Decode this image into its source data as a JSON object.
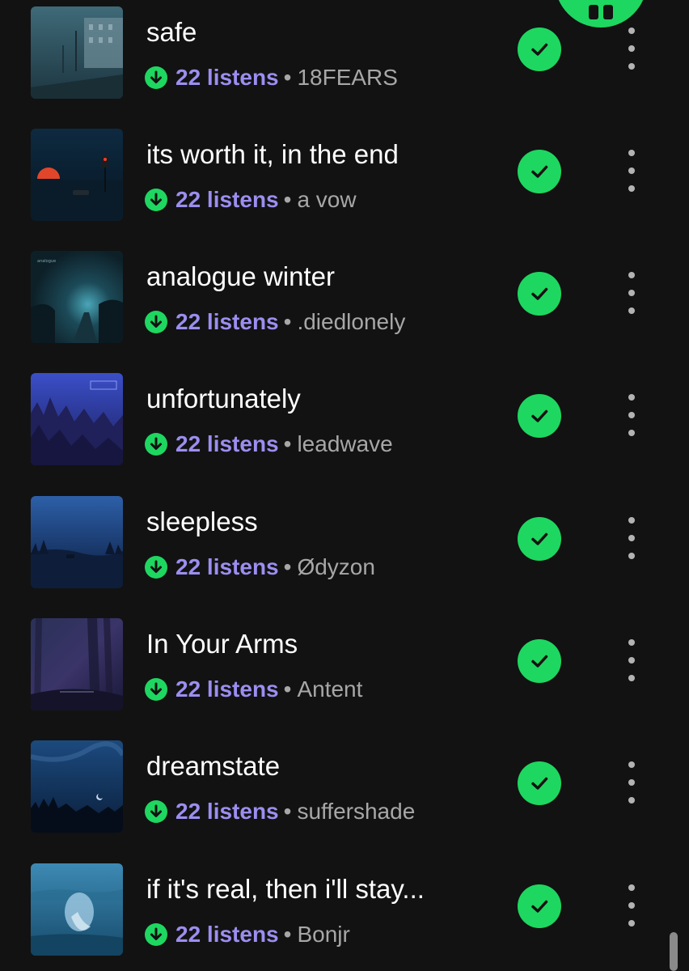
{
  "player": {
    "pause_icon": "pause-icon",
    "accent": "#1ed760"
  },
  "colors": {
    "background": "#121212",
    "listens": "#9b8ef0",
    "secondary_text": "#a7a7a7",
    "check_green": "#1ed760"
  },
  "tracks": [
    {
      "title": "safe",
      "listens": "22 listens",
      "separator": "•",
      "artist": "18FEARS",
      "downloaded": true,
      "added": true
    },
    {
      "title": "its worth it, in the end",
      "listens": "22 listens",
      "separator": "•",
      "artist": "a vow",
      "downloaded": true,
      "added": true
    },
    {
      "title": "analogue winter",
      "listens": "22 listens",
      "separator": "•",
      "artist": ".diedlonely",
      "downloaded": true,
      "added": true
    },
    {
      "title": "unfortunately",
      "listens": "22 listens",
      "separator": "•",
      "artist": "leadwave",
      "downloaded": true,
      "added": true
    },
    {
      "title": "sleepless",
      "listens": "22 listens",
      "separator": "•",
      "artist": "Ødyzon",
      "downloaded": true,
      "added": true
    },
    {
      "title": "In Your Arms",
      "listens": "22 listens",
      "separator": "•",
      "artist": "Antent",
      "downloaded": true,
      "added": true
    },
    {
      "title": "dreamstate",
      "listens": "22 listens",
      "separator": "•",
      "artist": "suffershade",
      "downloaded": true,
      "added": true
    },
    {
      "title": "if it's real, then i'll stay...",
      "listens": "22 listens",
      "separator": "•",
      "artist": "Bonjr",
      "downloaded": true,
      "added": true
    }
  ]
}
